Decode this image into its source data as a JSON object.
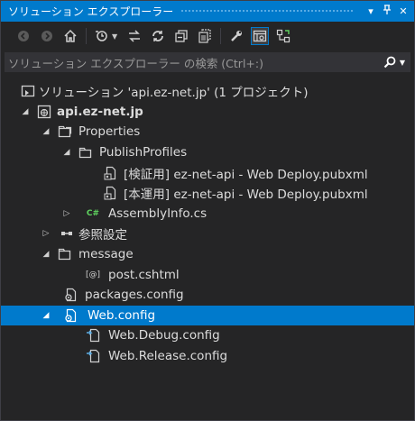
{
  "title": "ソリューション エクスプローラー",
  "title_controls": {
    "dropdown_icon": "dropdown-arrow-icon",
    "pin_icon": "pin-icon",
    "close_icon": "close-icon"
  },
  "toolbar": {
    "icons": [
      "back-icon",
      "forward-icon",
      "home-icon",
      "pending-changes-filter-icon",
      "sync-icon",
      "refresh-icon",
      "collapse-all-icon",
      "show-all-files-icon",
      "properties-icon",
      "preview-icon",
      "view-class-diagram-icon"
    ]
  },
  "search": {
    "placeholder": "ソリューション エクスプローラー の検索 (Ctrl+:)"
  },
  "tree": {
    "solution": "ソリューション 'api.ez-net.jp' (1 プロジェクト)",
    "project": "api.ez-net.jp",
    "properties": "Properties",
    "publish_profiles": "PublishProfiles",
    "profile_test": "[検証用] ez-net-api - Web Deploy.pubxml",
    "profile_prod": "[本運用] ez-net-api - Web Deploy.pubxml",
    "assembly_info": "AssemblyInfo.cs",
    "references": "参照設定",
    "message": "message",
    "post": "post.cshtml",
    "packages": "packages.config",
    "web_config": "Web.config",
    "web_debug": "Web.Debug.config",
    "web_release": "Web.Release.config"
  },
  "colors": {
    "accent": "#007acc",
    "background": "#252526",
    "csharp": "#5fd35f"
  }
}
